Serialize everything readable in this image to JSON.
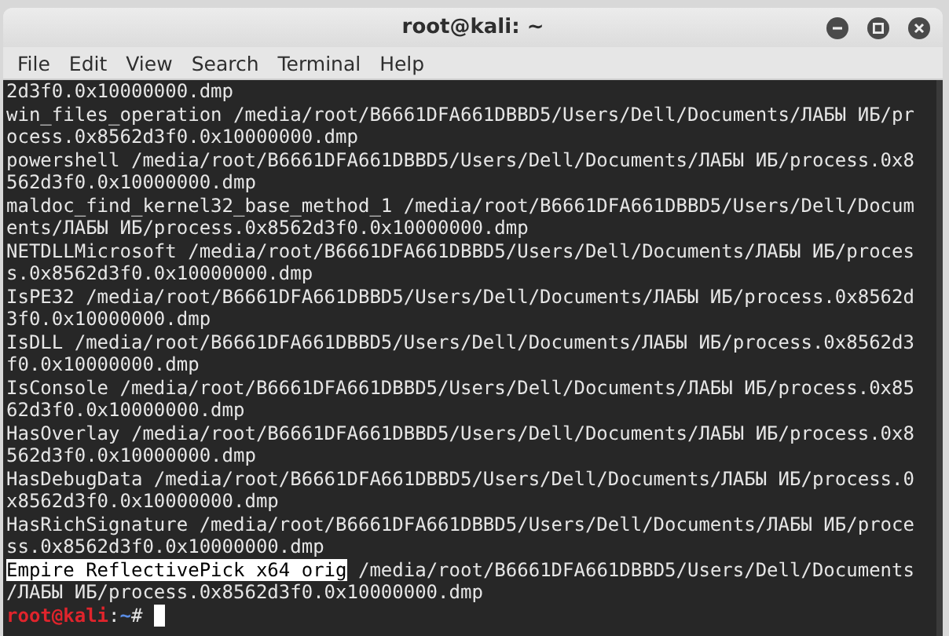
{
  "window": {
    "title": "root@kali: ~"
  },
  "menu": [
    "File",
    "Edit",
    "View",
    "Search",
    "Terminal",
    "Help"
  ],
  "terminal": {
    "lines": [
      {
        "kind": "output",
        "text": "2d3f0.0x10000000.dmp"
      },
      {
        "kind": "output",
        "text": "win_files_operation /media/root/B6661DFA661DBBD5/Users/Dell/Documents/ЛАБЫ ИБ/pr"
      },
      {
        "kind": "output",
        "text": "ocess.0x8562d3f0.0x10000000.dmp"
      },
      {
        "kind": "output",
        "text": "powershell /media/root/B6661DFA661DBBD5/Users/Dell/Documents/ЛАБЫ ИБ/process.0x8"
      },
      {
        "kind": "output",
        "text": "562d3f0.0x10000000.dmp"
      },
      {
        "kind": "output",
        "text": "maldoc_find_kernel32_base_method_1 /media/root/B6661DFA661DBBD5/Users/Dell/Docum"
      },
      {
        "kind": "output",
        "text": "ents/ЛАБЫ ИБ/process.0x8562d3f0.0x10000000.dmp"
      },
      {
        "kind": "output",
        "text": "NETDLLMicrosoft /media/root/B6661DFA661DBBD5/Users/Dell/Documents/ЛАБЫ ИБ/proces"
      },
      {
        "kind": "output",
        "text": "s.0x8562d3f0.0x10000000.dmp"
      },
      {
        "kind": "output",
        "text": "IsPE32 /media/root/B6661DFA661DBBD5/Users/Dell/Documents/ЛАБЫ ИБ/process.0x8562d"
      },
      {
        "kind": "output",
        "text": "3f0.0x10000000.dmp"
      },
      {
        "kind": "output",
        "text": "IsDLL /media/root/B6661DFA661DBBD5/Users/Dell/Documents/ЛАБЫ ИБ/process.0x8562d3"
      },
      {
        "kind": "output",
        "text": "f0.0x10000000.dmp"
      },
      {
        "kind": "output",
        "text": "IsConsole /media/root/B6661DFA661DBBD5/Users/Dell/Documents/ЛАБЫ ИБ/process.0x85"
      },
      {
        "kind": "output",
        "text": "62d3f0.0x10000000.dmp"
      },
      {
        "kind": "output",
        "text": "HasOverlay /media/root/B6661DFA661DBBD5/Users/Dell/Documents/ЛАБЫ ИБ/process.0x8"
      },
      {
        "kind": "output",
        "text": "562d3f0.0x10000000.dmp"
      },
      {
        "kind": "output",
        "text": "HasDebugData /media/root/B6661DFA661DBBD5/Users/Dell/Documents/ЛАБЫ ИБ/process.0"
      },
      {
        "kind": "output",
        "text": "x8562d3f0.0x10000000.dmp"
      },
      {
        "kind": "output",
        "text": "HasRichSignature /media/root/B6661DFA661DBBD5/Users/Dell/Documents/ЛАБЫ ИБ/proce"
      },
      {
        "kind": "output",
        "text": "ss.0x8562d3f0.0x10000000.dmp"
      },
      {
        "kind": "highlight",
        "match": "Empire ReflectivePick x64 orig",
        "rest": " /media/root/B6661DFA661DBBD5/Users/Dell/Documents"
      },
      {
        "kind": "output",
        "text": "/ЛАБЫ ИБ/process.0x8562d3f0.0x10000000.dmp"
      },
      {
        "kind": "prompt",
        "user_host": "root@kali",
        "separator": ":",
        "path": "~",
        "symbol": "#"
      }
    ]
  }
}
